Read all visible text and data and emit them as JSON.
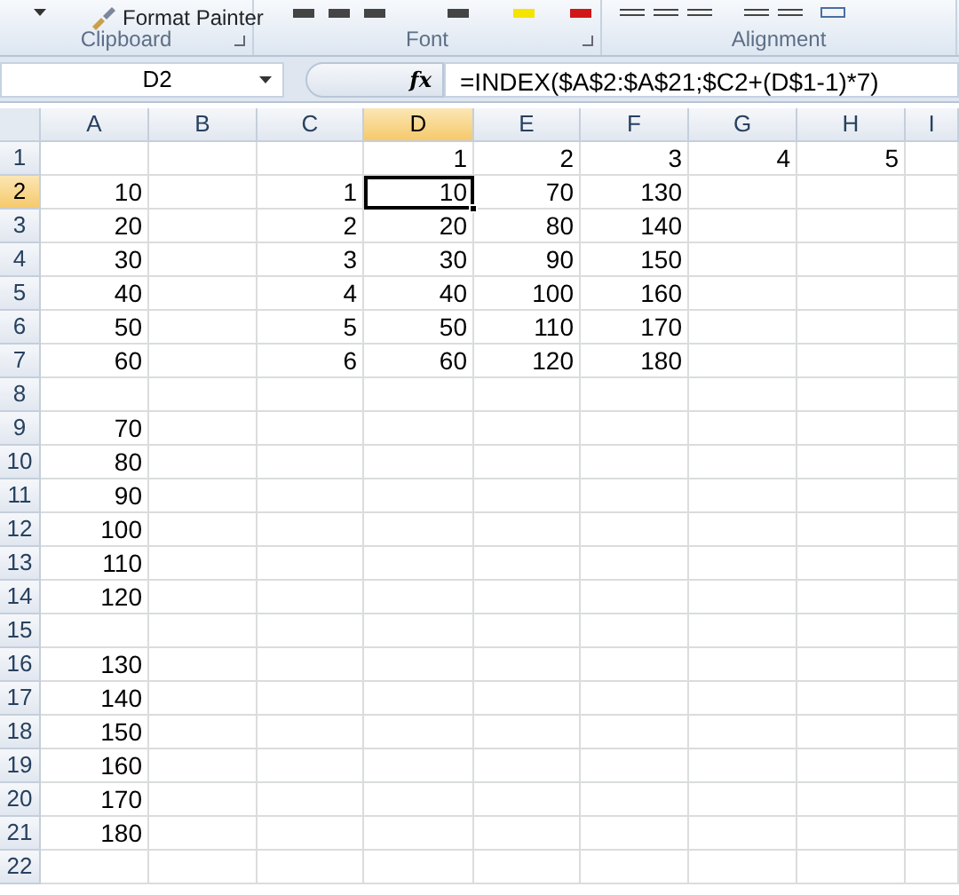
{
  "ribbon": {
    "groups": [
      {
        "label": "Clipboard",
        "items": [
          "Format Painter"
        ]
      },
      {
        "label": "Font"
      },
      {
        "label": "Alignment"
      }
    ]
  },
  "name_box": {
    "value": "D2"
  },
  "formula_bar": {
    "function_button": "fx",
    "value": "=INDEX($A$2:$A$21;$C2+(D$1-1)*7)"
  },
  "columns": [
    {
      "label": "A",
      "selected": false
    },
    {
      "label": "B",
      "selected": false
    },
    {
      "label": "C",
      "selected": false
    },
    {
      "label": "D",
      "selected": true
    },
    {
      "label": "E",
      "selected": false
    },
    {
      "label": "F",
      "selected": false
    },
    {
      "label": "G",
      "selected": false
    },
    {
      "label": "H",
      "selected": false
    },
    {
      "label": "I",
      "selected": false
    }
  ],
  "rows": [
    {
      "label": "1",
      "selected": false,
      "cells": [
        "",
        "",
        "",
        "1",
        "2",
        "3",
        "4",
        "5",
        ""
      ]
    },
    {
      "label": "2",
      "selected": true,
      "cells": [
        "10",
        "",
        "1",
        "10",
        "70",
        "130",
        "",
        "",
        ""
      ]
    },
    {
      "label": "3",
      "selected": false,
      "cells": [
        "20",
        "",
        "2",
        "20",
        "80",
        "140",
        "",
        "",
        ""
      ]
    },
    {
      "label": "4",
      "selected": false,
      "cells": [
        "30",
        "",
        "3",
        "30",
        "90",
        "150",
        "",
        "",
        ""
      ]
    },
    {
      "label": "5",
      "selected": false,
      "cells": [
        "40",
        "",
        "4",
        "40",
        "100",
        "160",
        "",
        "",
        ""
      ]
    },
    {
      "label": "6",
      "selected": false,
      "cells": [
        "50",
        "",
        "5",
        "50",
        "110",
        "170",
        "",
        "",
        ""
      ]
    },
    {
      "label": "7",
      "selected": false,
      "cells": [
        "60",
        "",
        "6",
        "60",
        "120",
        "180",
        "",
        "",
        ""
      ]
    },
    {
      "label": "8",
      "selected": false,
      "cells": [
        "",
        "",
        "",
        "",
        "",
        "",
        "",
        "",
        ""
      ]
    },
    {
      "label": "9",
      "selected": false,
      "cells": [
        "70",
        "",
        "",
        "",
        "",
        "",
        "",
        "",
        ""
      ]
    },
    {
      "label": "10",
      "selected": false,
      "cells": [
        "80",
        "",
        "",
        "",
        "",
        "",
        "",
        "",
        ""
      ]
    },
    {
      "label": "11",
      "selected": false,
      "cells": [
        "90",
        "",
        "",
        "",
        "",
        "",
        "",
        "",
        ""
      ]
    },
    {
      "label": "12",
      "selected": false,
      "cells": [
        "100",
        "",
        "",
        "",
        "",
        "",
        "",
        "",
        ""
      ]
    },
    {
      "label": "13",
      "selected": false,
      "cells": [
        "110",
        "",
        "",
        "",
        "",
        "",
        "",
        "",
        ""
      ]
    },
    {
      "label": "14",
      "selected": false,
      "cells": [
        "120",
        "",
        "",
        "",
        "",
        "",
        "",
        "",
        ""
      ]
    },
    {
      "label": "15",
      "selected": false,
      "cells": [
        "",
        "",
        "",
        "",
        "",
        "",
        "",
        "",
        ""
      ]
    },
    {
      "label": "16",
      "selected": false,
      "cells": [
        "130",
        "",
        "",
        "",
        "",
        "",
        "",
        "",
        ""
      ]
    },
    {
      "label": "17",
      "selected": false,
      "cells": [
        "140",
        "",
        "",
        "",
        "",
        "",
        "",
        "",
        ""
      ]
    },
    {
      "label": "18",
      "selected": false,
      "cells": [
        "150",
        "",
        "",
        "",
        "",
        "",
        "",
        "",
        ""
      ]
    },
    {
      "label": "19",
      "selected": false,
      "cells": [
        "160",
        "",
        "",
        "",
        "",
        "",
        "",
        "",
        ""
      ]
    },
    {
      "label": "20",
      "selected": false,
      "cells": [
        "170",
        "",
        "",
        "",
        "",
        "",
        "",
        "",
        ""
      ]
    },
    {
      "label": "21",
      "selected": false,
      "cells": [
        "180",
        "",
        "",
        "",
        "",
        "",
        "",
        "",
        ""
      ]
    },
    {
      "label": "22",
      "selected": false,
      "cells": [
        "",
        "",
        "",
        "",
        "",
        "",
        "",
        "",
        ""
      ]
    }
  ]
}
